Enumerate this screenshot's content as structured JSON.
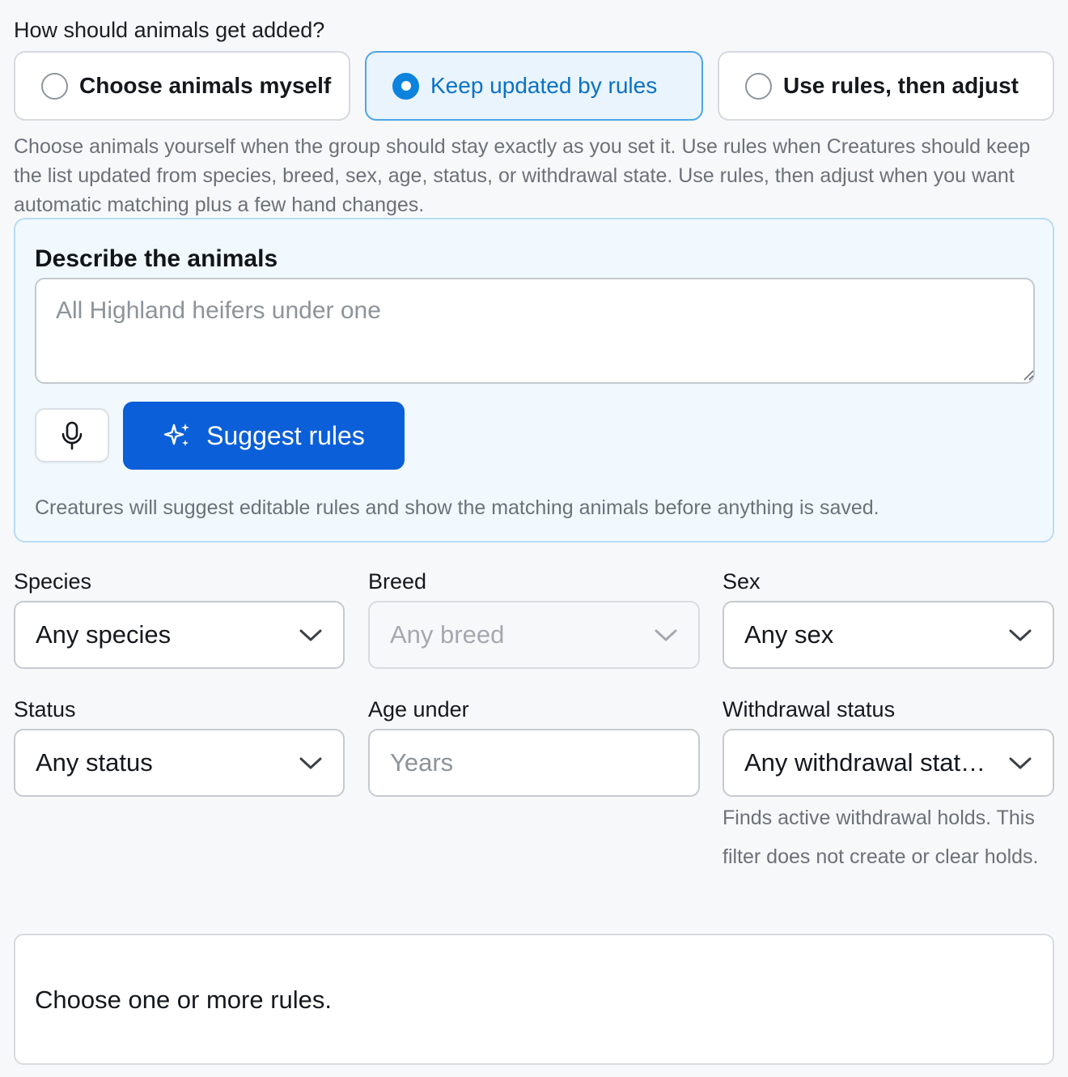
{
  "question": "How should animals get added?",
  "modes": [
    {
      "label": "Choose animals myself",
      "selected": false
    },
    {
      "label": "Keep updated by rules",
      "selected": true
    },
    {
      "label": "Use rules, then adjust",
      "selected": false
    }
  ],
  "help_text": "Choose animals yourself when the group should stay exactly as you set it. Use rules when Creatures should keep the list updated from species, breed, sex, age, status, or withdrawal state. Use rules, then adjust when you want automatic matching plus a few hand changes.",
  "describe": {
    "title": "Describe the animals",
    "placeholder": "All Highland heifers under one",
    "suggest_label": "Suggest rules",
    "note": "Creatures will suggest editable rules and show the matching animals before anything is saved."
  },
  "filters": {
    "species": {
      "label": "Species",
      "value": "Any species"
    },
    "breed": {
      "label": "Breed",
      "value": "Any breed",
      "disabled": true
    },
    "sex": {
      "label": "Sex",
      "value": "Any sex"
    },
    "status": {
      "label": "Status",
      "value": "Any status"
    },
    "age": {
      "label": "Age under",
      "placeholder": "Years"
    },
    "withdrawal": {
      "label": "Withdrawal status",
      "value": "Any withdrawal stat…",
      "note": "Finds active withdrawal holds. This filter does not create or clear holds."
    }
  },
  "empty_state": "Choose one or more rules.",
  "colors": {
    "accent": "#0b5fd8",
    "radio_selected": "#0d83dd",
    "selected_bg": "#e9f4fd",
    "panel_bg": "#f1f9fe",
    "page_bg": "#f7f8fa"
  },
  "icons": {
    "mic": "microphone-icon",
    "sparkle": "sparkle-icon",
    "chevron": "chevron-down-icon"
  }
}
